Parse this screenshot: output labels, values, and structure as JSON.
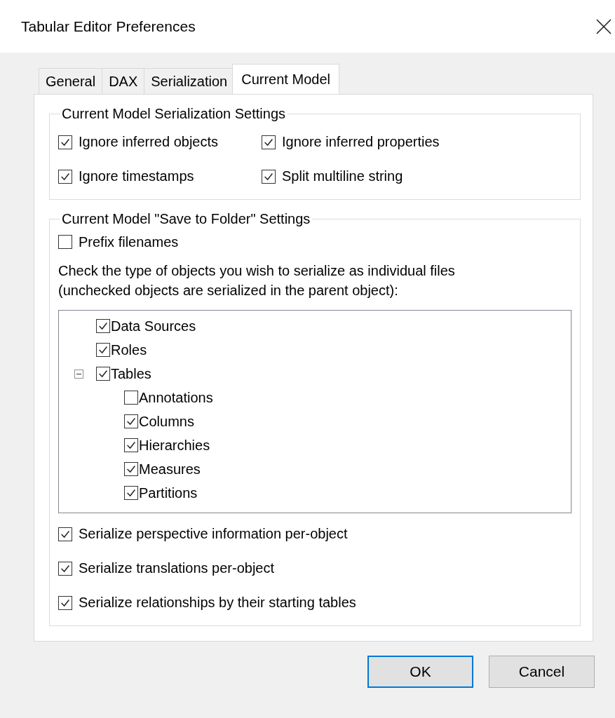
{
  "window": {
    "title": "Tabular Editor Preferences"
  },
  "tabs": [
    {
      "label": "General",
      "selected": false
    },
    {
      "label": "DAX",
      "selected": false
    },
    {
      "label": "Serialization",
      "selected": false
    },
    {
      "label": "Current Model",
      "selected": true
    }
  ],
  "serialization_settings": {
    "title": "Current Model Serialization Settings",
    "options": [
      {
        "label": "Ignore inferred objects",
        "checked": true
      },
      {
        "label": "Ignore inferred properties",
        "checked": true
      },
      {
        "label": "Ignore timestamps",
        "checked": true
      },
      {
        "label": "Split multiline string",
        "checked": true
      }
    ]
  },
  "save_to_folder": {
    "title": "Current Model \"Save to Folder\" Settings",
    "prefix_filenames": {
      "label": "Prefix filenames",
      "checked": false
    },
    "instructions": [
      "Check the type of objects you wish to serialize as individual files",
      "(unchecked objects are serialized in the parent object):"
    ],
    "object_tree": [
      {
        "label": "Data Sources",
        "checked": true
      },
      {
        "label": "Roles",
        "checked": true
      },
      {
        "label": "Tables",
        "checked": true,
        "expanded": true,
        "children": [
          {
            "label": "Annotations",
            "checked": false
          },
          {
            "label": "Columns",
            "checked": true
          },
          {
            "label": "Hierarchies",
            "checked": true
          },
          {
            "label": "Measures",
            "checked": true
          },
          {
            "label": "Partitions",
            "checked": true
          }
        ]
      }
    ],
    "options": [
      {
        "label": "Serialize perspective information per-object",
        "checked": true
      },
      {
        "label": "Serialize translations per-object",
        "checked": true
      },
      {
        "label": "Serialize relationships by their starting tables",
        "checked": true
      }
    ]
  },
  "buttons": [
    {
      "label": "OK",
      "default": true
    },
    {
      "label": "Cancel",
      "default": false
    }
  ]
}
